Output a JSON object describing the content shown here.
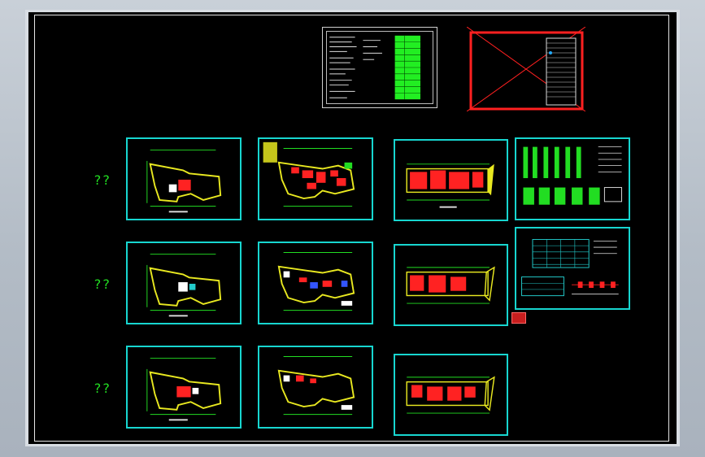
{
  "row_labels": [
    "??",
    "??",
    "??"
  ],
  "colors": {
    "sheet_border": "#17d6d0",
    "void_cross": "#ff2020",
    "row_label": "#22dd22",
    "canvas": "#000000"
  },
  "icons": {
    "sheet_preview": "cad-drawing-thumbnail",
    "void_mark": "red-cross-mark"
  }
}
